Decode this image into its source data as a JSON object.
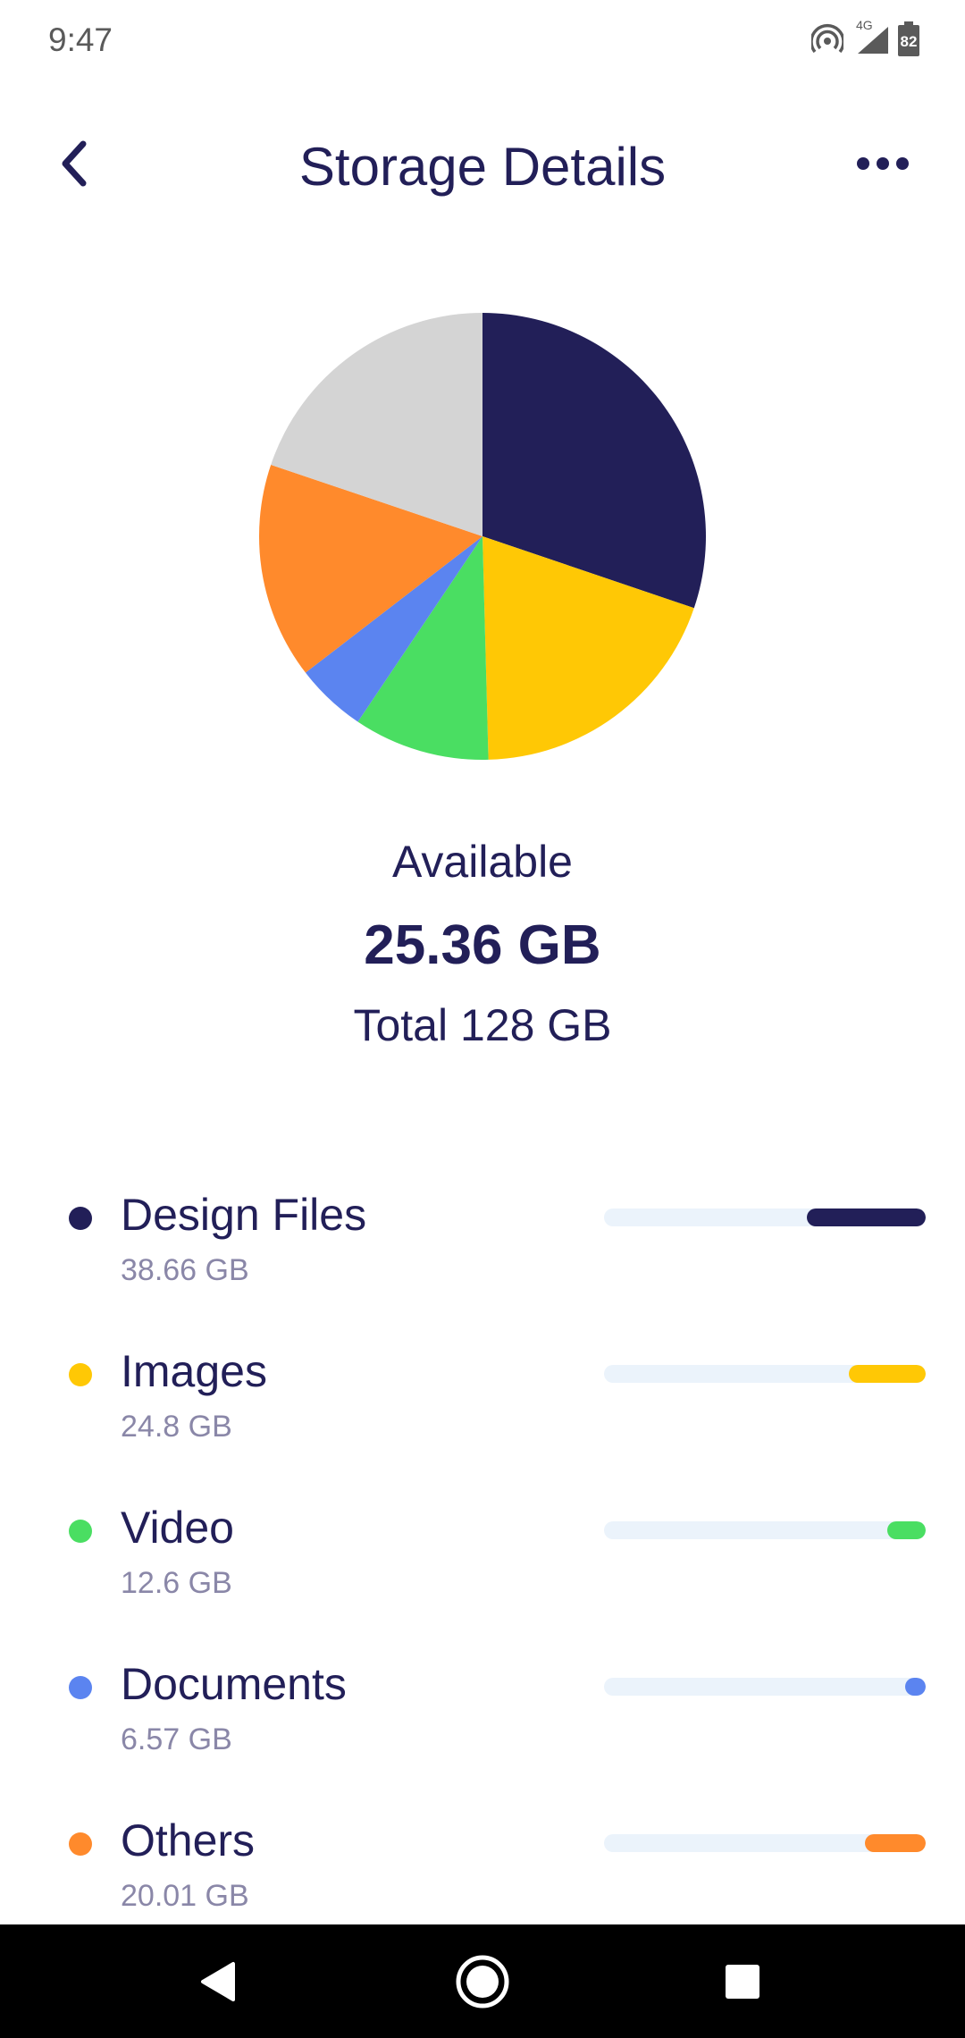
{
  "status_bar": {
    "time": "9:47",
    "network": "4G",
    "battery": "82",
    "icons": [
      "hotspot-icon",
      "signal-icon",
      "battery-icon"
    ]
  },
  "header": {
    "title": "Storage Details",
    "back_icon": "chevron-left-icon",
    "more_icon": "more-horizontal-icon"
  },
  "summary": {
    "available_label": "Available",
    "available_value": "25.36 GB",
    "total_label": "Total 128 GB"
  },
  "chart_data": {
    "type": "pie",
    "slices": [
      {
        "label": "Design Files",
        "value": 38.66,
        "color": "#221f58"
      },
      {
        "label": "Images",
        "value": 24.8,
        "color": "#ffc805"
      },
      {
        "label": "Video",
        "value": 12.6,
        "color": "#4ade62"
      },
      {
        "label": "Documents",
        "value": 6.57,
        "color": "#5b84f0"
      },
      {
        "label": "Others",
        "value": 20.01,
        "color": "#ff8a2c"
      },
      {
        "label": "Available",
        "value": 25.36,
        "color": "#d4d4d4"
      }
    ],
    "total": 128
  },
  "categories": [
    {
      "name": "Design Files",
      "size": "38.66 GB",
      "color": "#221f58",
      "fill": 0.37
    },
    {
      "name": "Images",
      "size": "24.8 GB",
      "color": "#ffc805",
      "fill": 0.24
    },
    {
      "name": "Video",
      "size": "12.6 GB",
      "color": "#4ade62",
      "fill": 0.12
    },
    {
      "name": "Documents",
      "size": "6.57 GB",
      "color": "#5b84f0",
      "fill": 0.063
    },
    {
      "name": "Others",
      "size": "20.01 GB",
      "color": "#ff8a2c",
      "fill": 0.19
    }
  ],
  "nav": {
    "icons": [
      "back-triangle-icon",
      "home-circle-icon",
      "recents-square-icon"
    ]
  }
}
